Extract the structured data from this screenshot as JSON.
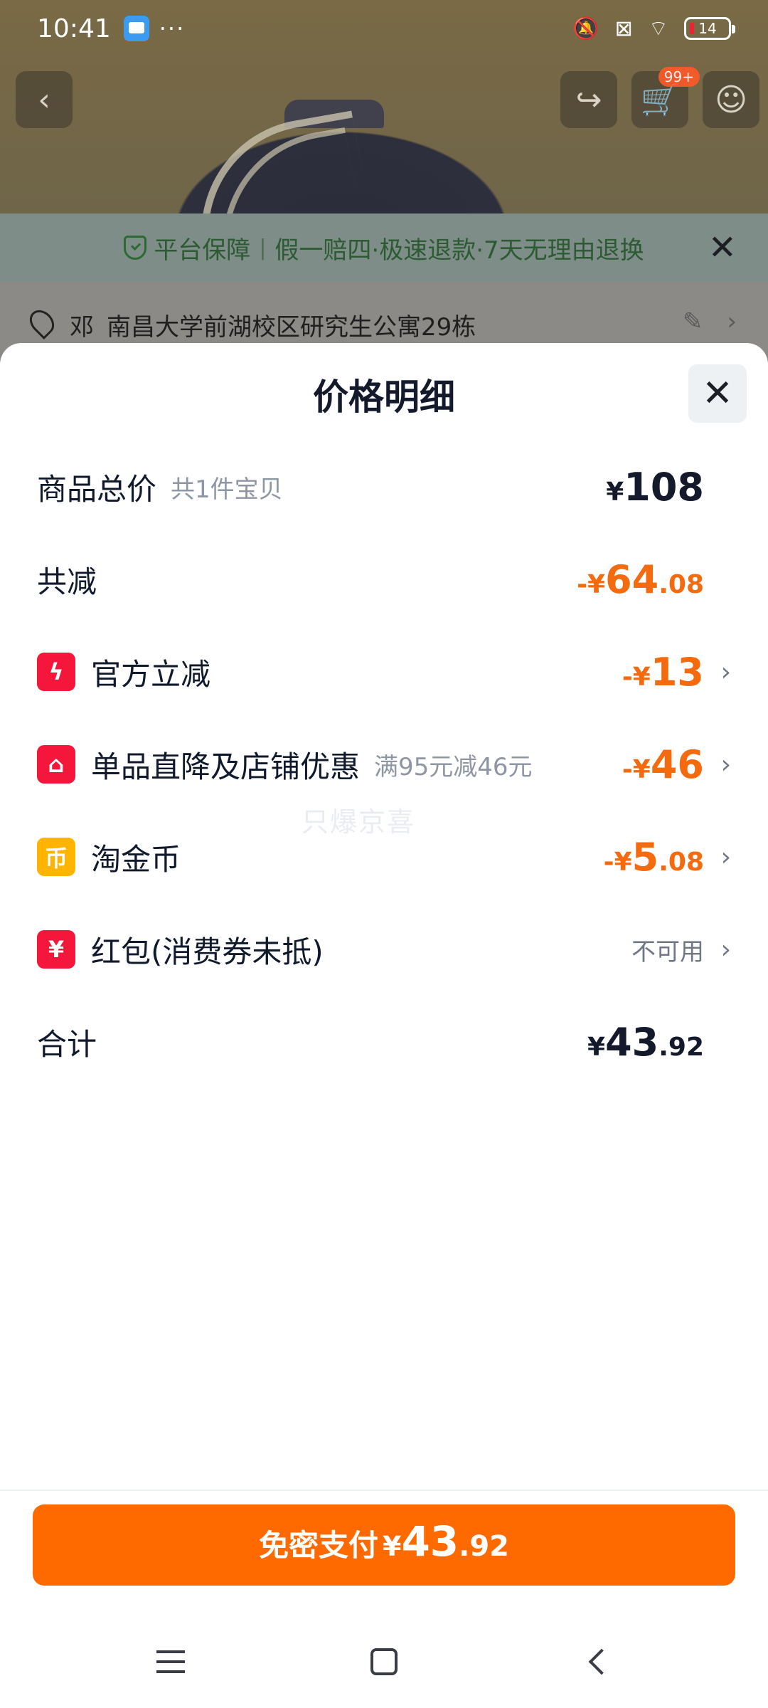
{
  "status_bar": {
    "time": "10:41",
    "dots": "···",
    "battery": "14",
    "icons": [
      "app-icon",
      "mute-icon",
      "sim-off-icon",
      "wifi-icon",
      "battery-icon"
    ]
  },
  "background_page": {
    "nav_icons": [
      "back-icon",
      "share-icon",
      "cart-icon",
      "more-icon"
    ],
    "cart_badge": "99+",
    "guarantee": {
      "title": "平台保障",
      "text": "假一赔四·极速退款·7天无理由退换"
    },
    "address": {
      "name": "邓",
      "text": "南昌大学前湖校区研究生公寓29栋"
    }
  },
  "sheet": {
    "title": "价格明细",
    "rows": [
      {
        "label": "商品总价",
        "sub": "共1件宝贝",
        "currency": "¥",
        "integer": "108",
        "decimal": ""
      },
      {
        "label": "共减",
        "currency": "-¥",
        "integer": "64",
        "decimal": ".08"
      },
      {
        "label": "官方立减",
        "icon": "lightning-icon",
        "currency": "-¥",
        "integer": "13",
        "decimal": ""
      },
      {
        "label": "单品直降及店铺优惠",
        "sub": "满95元减46元",
        "icon": "shop-icon",
        "currency": "-¥",
        "integer": "46",
        "decimal": ""
      },
      {
        "label": "淘金币",
        "icon": "coin-icon",
        "currency": "-¥",
        "integer": "5",
        "decimal": ".08"
      },
      {
        "label": "红包(消费券未抵)",
        "icon": "red-packet-icon",
        "status": "不可用"
      },
      {
        "label": "合计",
        "currency": "¥",
        "integer": "43",
        "decimal": ".92"
      }
    ],
    "watermark": "只爆京喜"
  },
  "pay_button": {
    "label": "免密支付",
    "currency": "¥",
    "integer": "43",
    "decimal": ".92"
  },
  "colors": {
    "accent_orange": "#ff6a00",
    "discount_orange": "#f36a0f",
    "icon_red": "#f4173b",
    "icon_yellow": "#ffb400"
  }
}
